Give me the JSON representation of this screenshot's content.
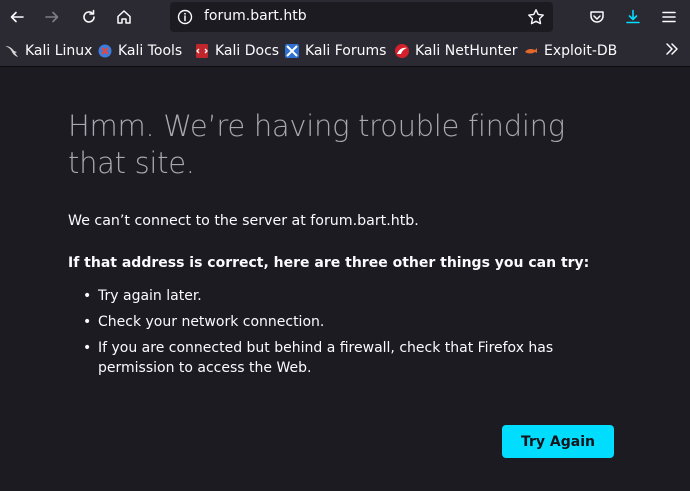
{
  "browser": {
    "url": "forum.bart.htb",
    "toolbar_icons": [
      "back-arrow-icon",
      "forward-arrow-icon",
      "reload-icon",
      "home-icon",
      "info-icon",
      "star-icon",
      "pocket-icon",
      "download-icon",
      "menu-icon"
    ],
    "accent": "#00ddff"
  },
  "bookmarks": [
    {
      "label": "Kali Linux",
      "icon": "kali-linux-icon"
    },
    {
      "label": "Kali Tools",
      "icon": "kali-tools-icon"
    },
    {
      "label": "Kali Docs",
      "icon": "kali-docs-icon"
    },
    {
      "label": "Kali Forums",
      "icon": "kali-forums-icon"
    },
    {
      "label": "Kali NetHunter",
      "icon": "kali-nethunter-icon"
    },
    {
      "label": "Exploit-DB",
      "icon": "exploit-db-icon"
    }
  ],
  "error": {
    "title_line1": "Hmm. We’re having trouble finding",
    "title_line2": "that site.",
    "message": "We can’t connect to the server at forum.bart.htb.",
    "heading": "If that address is correct, here are three other things you can try:",
    "items": [
      "Try again later.",
      "Check your network connection.",
      "If you are connected but behind a firewall, check that Firefox has permission to access the Web."
    ],
    "button_label": "Try Again"
  }
}
